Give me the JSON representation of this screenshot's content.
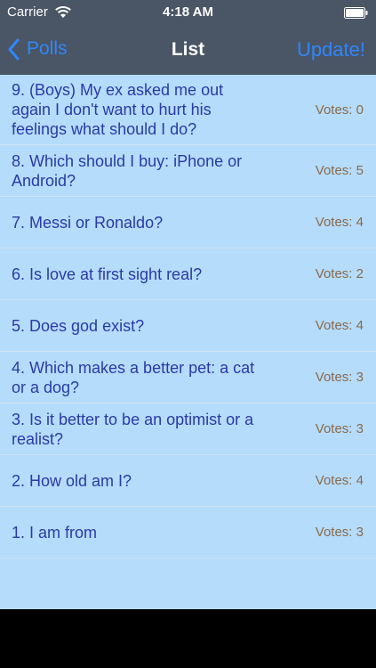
{
  "status_bar": {
    "carrier": "Carrier",
    "time": "4:18 AM"
  },
  "nav": {
    "back_label": "Polls",
    "title": "List",
    "update_label": "Update!"
  },
  "polls": [
    {
      "question": "9. (Boys) My ex asked me out again I don't want to hurt his feelings what should I do?",
      "votes": "Votes: 0"
    },
    {
      "question": "8. Which should I buy: iPhone or Android?",
      "votes": "Votes: 5"
    },
    {
      "question": "7. Messi or Ronaldo?",
      "votes": "Votes: 4"
    },
    {
      "question": "6. Is love at first sight real?",
      "votes": "Votes: 2"
    },
    {
      "question": "5. Does god exist?",
      "votes": "Votes: 4"
    },
    {
      "question": "4. Which makes a better pet: a cat or a dog?",
      "votes": "Votes: 3"
    },
    {
      "question": "3. Is it better to be an optimist or a realist?",
      "votes": "Votes: 3"
    },
    {
      "question": "2. How old am I?",
      "votes": "Votes: 4"
    },
    {
      "question": "1. I am from",
      "votes": "Votes: 3"
    }
  ],
  "colors": {
    "nav_bg": "#4a5565",
    "accent": "#2e87ff",
    "list_bg": "#b5dcfb",
    "question_text": "#2a3aa8",
    "votes_text": "#8a6a4c"
  },
  "icons": {
    "wifi": "wifi-icon",
    "battery": "battery-icon",
    "back": "chevron-left-icon"
  }
}
